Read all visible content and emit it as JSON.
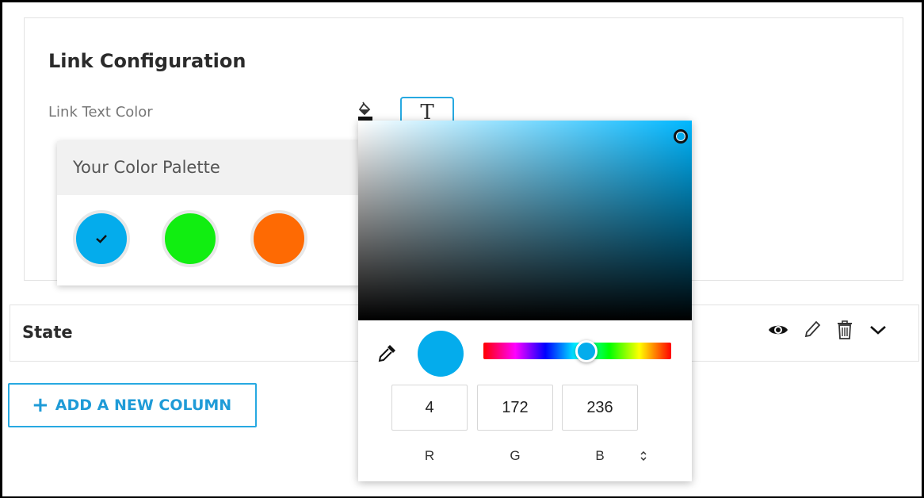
{
  "link_config": {
    "title": "Link Configuration",
    "text_color_label": "Link Text Color",
    "text_style_button": "T"
  },
  "palette": {
    "title": "Your Color Palette",
    "swatches": [
      {
        "color": "#04acec",
        "selected": true
      },
      {
        "color": "#11ee11",
        "selected": false
      },
      {
        "color": "#fe6a03",
        "selected": false
      }
    ]
  },
  "color_picker": {
    "hue_color": "#00b7ff",
    "preview_color": "#04acec",
    "hue_thumb_position": 0.55,
    "r_value": "4",
    "g_value": "172",
    "b_value": "236",
    "r_label": "R",
    "g_label": "G",
    "b_label": "B"
  },
  "state_row": {
    "label": "State",
    "icons": [
      "eye-icon",
      "pencil-icon",
      "trash-icon",
      "chevron-down-icon"
    ]
  },
  "add_column_button": {
    "label": "ADD A NEW COLUMN"
  },
  "colors": {
    "accent": "#27a9e1"
  }
}
